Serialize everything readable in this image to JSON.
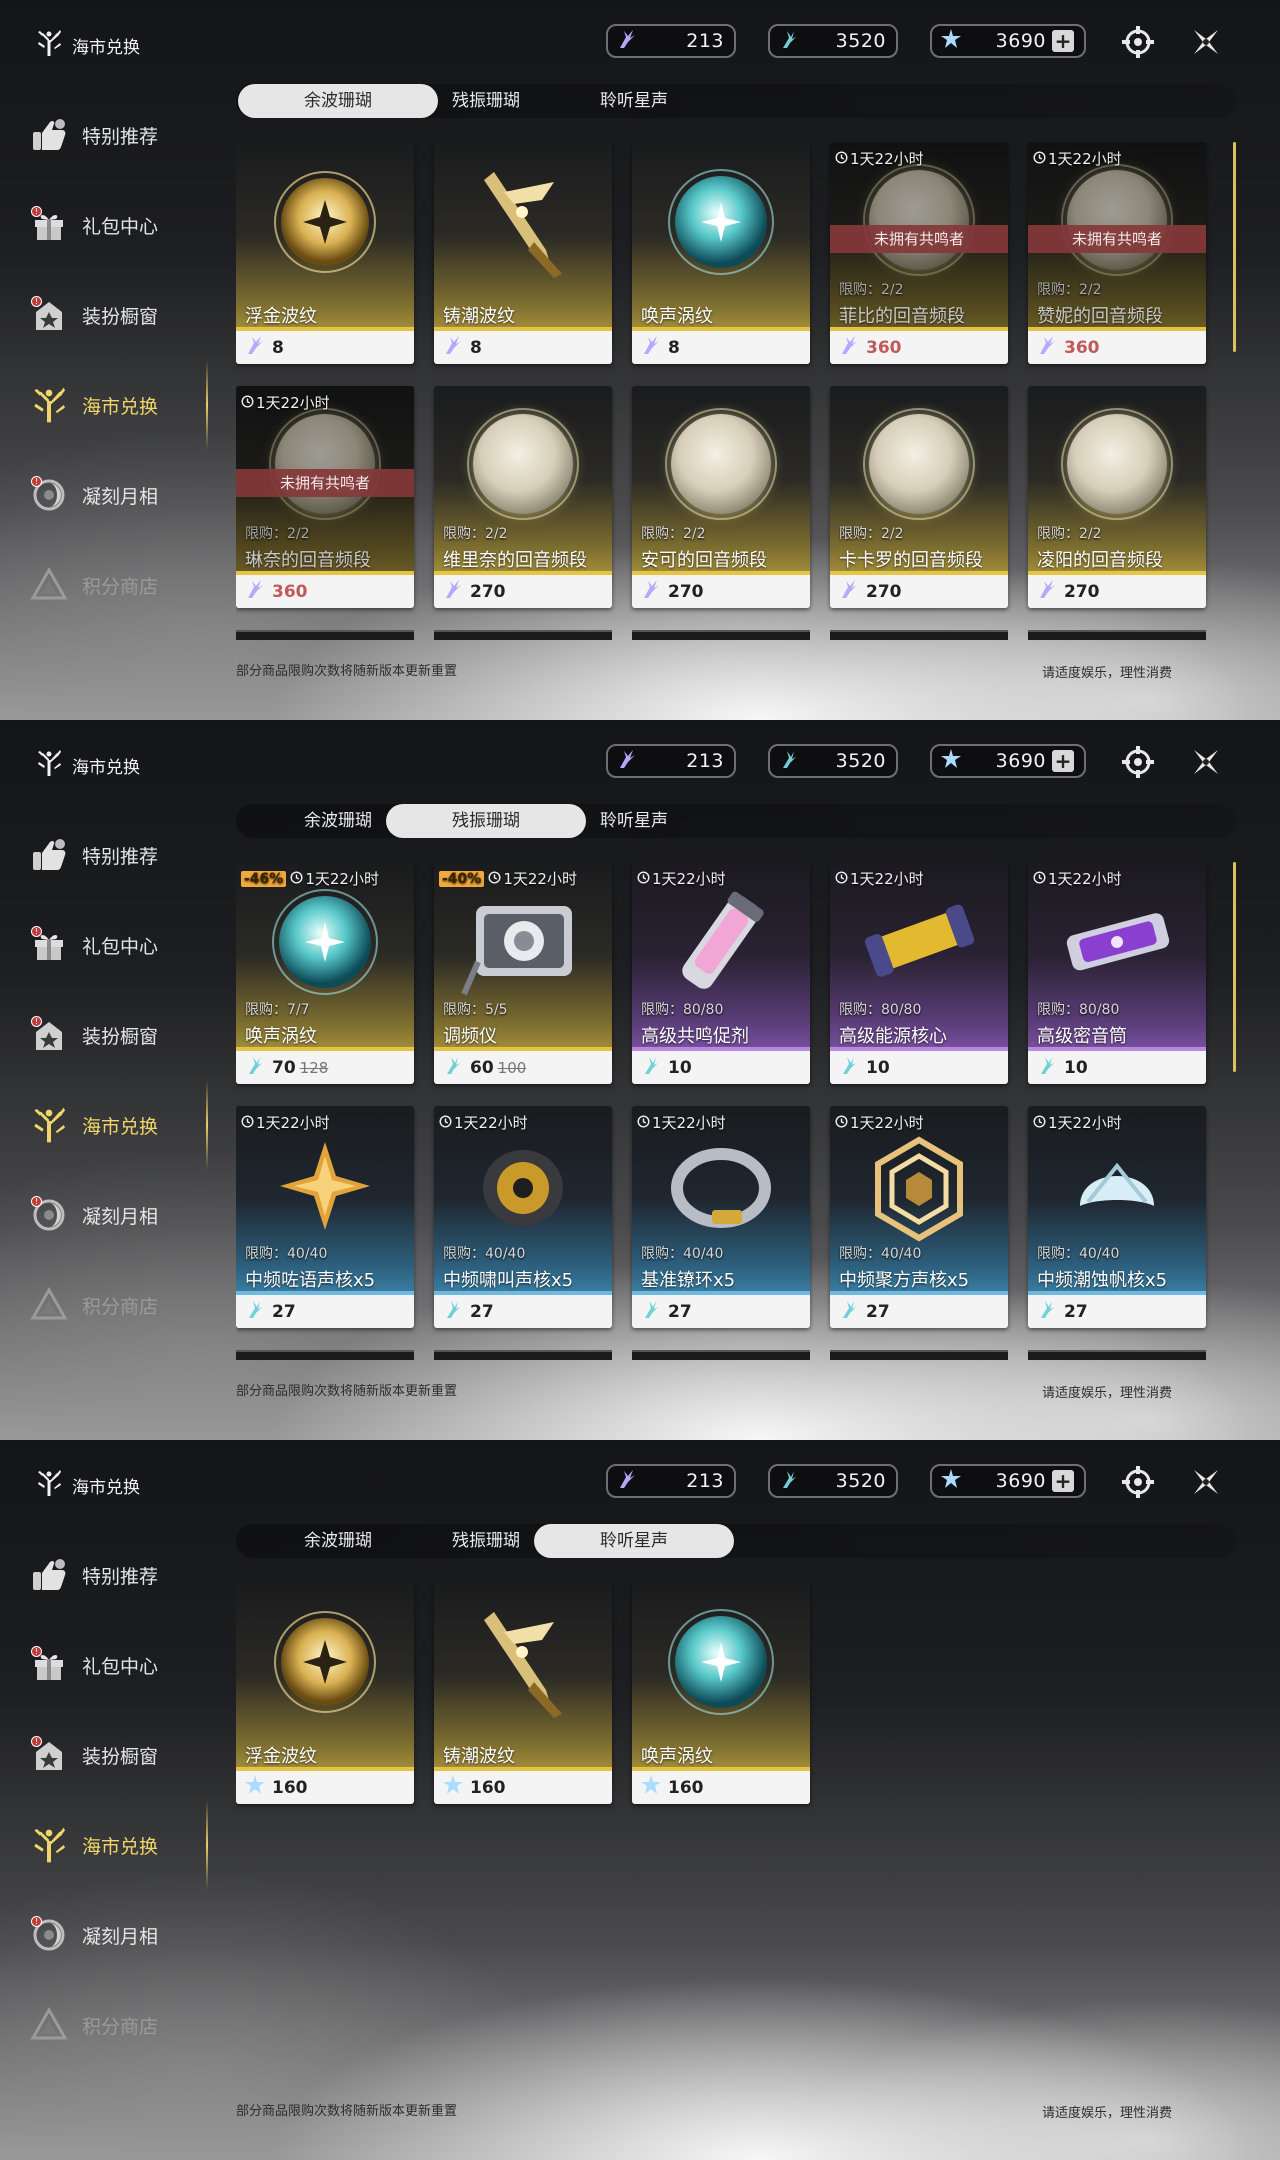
{
  "header": {
    "title": "海市兑换"
  },
  "currencies": [
    {
      "icon": "wave-coral-icon",
      "value": "213"
    },
    {
      "icon": "resonance-coral-icon",
      "value": "3520"
    },
    {
      "icon": "star-icon",
      "value": "3690"
    }
  ],
  "plus_label": "+",
  "sidebar": {
    "items": [
      {
        "label": "特别推荐",
        "icon": "recommend-icon"
      },
      {
        "label": "礼包中心",
        "icon": "gift-icon"
      },
      {
        "label": "装扮橱窗",
        "icon": "wardrobe-icon"
      },
      {
        "label": "海市兑换",
        "icon": "coral-tree-icon"
      },
      {
        "label": "凝刻月相",
        "icon": "moon-phase-icon"
      },
      {
        "label": "积分商店",
        "icon": "points-shop-icon"
      }
    ]
  },
  "tabs": [
    "余波珊瑚",
    "残振珊瑚",
    "聆听星声"
  ],
  "footer": {
    "left": "部分商品限购次数将随新版本更新重置",
    "right": "请适度娱乐，理性消费"
  },
  "timer_text": "1天22小时",
  "unowned_text": "未拥有共鸣者",
  "panel1_cards": [
    {
      "name": "浮金波纹",
      "price": "8",
      "art": "gold"
    },
    {
      "name": "铸潮波纹",
      "price": "8",
      "art": "blade"
    },
    {
      "name": "唤声涡纹",
      "price": "8",
      "art": "teal"
    },
    {
      "name": "菲比的回音频段",
      "price": "360",
      "limit": "限购：2/2"
    },
    {
      "name": "赞妮的回音频段",
      "price": "360",
      "limit": "限购：2/2"
    },
    {
      "name": "琳奈的回音频段",
      "price": "360",
      "limit": "限购：2/2"
    },
    {
      "name": "维里奈的回音频段",
      "price": "270",
      "limit": "限购：2/2"
    },
    {
      "name": "安可的回音频段",
      "price": "270",
      "limit": "限购：2/2"
    },
    {
      "name": "卡卡罗的回音频段",
      "price": "270",
      "limit": "限购：2/2"
    },
    {
      "name": "凌阳的回音频段",
      "price": "270",
      "limit": "限购：2/2"
    }
  ],
  "panel2_cards": [
    {
      "name": "唤声涡纹",
      "price": "70",
      "old": "128",
      "limit": "限购：7/7",
      "discount": "-46%"
    },
    {
      "name": "调频仪",
      "price": "60",
      "old": "100",
      "limit": "限购：5/5",
      "discount": "-40%"
    },
    {
      "name": "高级共鸣促剂",
      "price": "10",
      "limit": "限购：80/80"
    },
    {
      "name": "高级能源核心",
      "price": "10",
      "limit": "限购：80/80"
    },
    {
      "name": "高级密音筒",
      "price": "10",
      "limit": "限购：80/80"
    },
    {
      "name": "中频咗语声核x5",
      "price": "27",
      "limit": "限购：40/40"
    },
    {
      "name": "中频啸叫声核x5",
      "price": "27",
      "limit": "限购：40/40"
    },
    {
      "name": "基准镣环x5",
      "price": "27",
      "limit": "限购：40/40"
    },
    {
      "name": "中频聚方声核x5",
      "price": "27",
      "limit": "限购：40/40"
    },
    {
      "name": "中频潮蚀帆核x5",
      "price": "27",
      "limit": "限购：40/40"
    }
  ],
  "panel3_cards": [
    {
      "name": "浮金波纹",
      "price": "160"
    },
    {
      "name": "铸潮波纹",
      "price": "160"
    },
    {
      "name": "唤声涡纹",
      "price": "160"
    }
  ],
  "colors": {
    "accent_gold": "#f0d66a",
    "locked_red": "#c05a5a",
    "ribbon": "#84383a"
  }
}
